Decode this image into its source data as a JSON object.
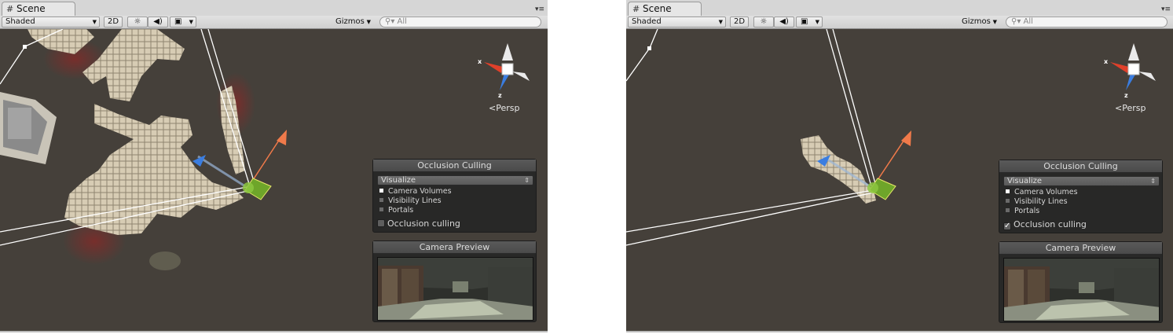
{
  "windows": [
    {
      "tab": {
        "title": "Scene"
      },
      "toolbar": {
        "draw_mode": "Shaded",
        "mode_2d": "2D",
        "lighting_icon": "sun-icon",
        "audio_icon": "speaker-icon",
        "effects_icon": "image-icon",
        "gizmos": "Gizmos",
        "search_placeholder": "All"
      },
      "gizmo": {
        "x_label": "x",
        "z_label": "z",
        "projection": "Persp"
      },
      "occlusion_panel": {
        "title": "Occlusion Culling",
        "dropdown": "Visualize",
        "options": [
          {
            "label": "Camera Volumes",
            "checked": true
          },
          {
            "label": "Visibility Lines",
            "checked": false
          },
          {
            "label": "Portals",
            "checked": false
          }
        ],
        "occlusion_culling_label": "Occlusion culling",
        "occlusion_culling_checked": false
      },
      "camera_preview": {
        "title": "Camera Preview"
      }
    },
    {
      "tab": {
        "title": "Scene"
      },
      "toolbar": {
        "draw_mode": "Shaded",
        "mode_2d": "2D",
        "lighting_icon": "sun-icon",
        "audio_icon": "speaker-icon",
        "effects_icon": "image-icon",
        "gizmos": "Gizmos",
        "search_placeholder": "All"
      },
      "gizmo": {
        "x_label": "x",
        "z_label": "z",
        "projection": "Persp"
      },
      "occlusion_panel": {
        "title": "Occlusion Culling",
        "dropdown": "Visualize",
        "options": [
          {
            "label": "Camera Volumes",
            "checked": true
          },
          {
            "label": "Visibility Lines",
            "checked": false
          },
          {
            "label": "Portals",
            "checked": false
          }
        ],
        "occlusion_culling_label": "Occlusion culling",
        "occlusion_culling_checked": true
      },
      "camera_preview": {
        "title": "Camera Preview"
      }
    }
  ],
  "colors": {
    "viewport_bg": "#45403a",
    "tile": "#d7ccb4",
    "tile_edge": "#8f8570",
    "gizmo_x": "#e0402a",
    "gizmo_z": "#3a7de0",
    "selection_green": "#8cc63f",
    "move_arrow": "#f07a4a"
  }
}
